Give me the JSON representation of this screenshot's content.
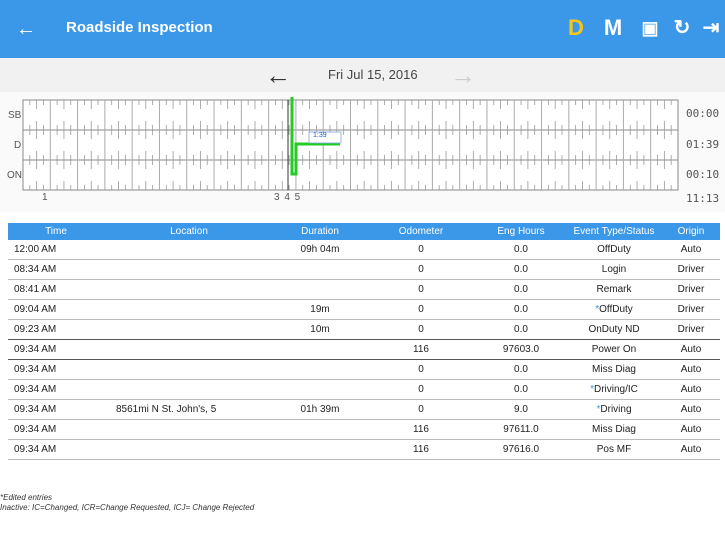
{
  "appbar": {
    "title": "Roadside Inspection",
    "back_icon": "arrow-left-icon",
    "actions": [
      {
        "name": "d-button",
        "label": "D",
        "color": "#f5c518"
      },
      {
        "name": "m-button",
        "label": "M",
        "color": "#ffffff"
      },
      {
        "name": "logbook-icon",
        "label": "▣",
        "color": "#ffffff"
      },
      {
        "name": "refresh-icon",
        "label": "↻",
        "color": "#ffffff"
      },
      {
        "name": "logout-icon",
        "label": "⇥",
        "color": "#ffffff"
      }
    ],
    "color": "#3b97e8"
  },
  "datebar": {
    "date": "Fri Jul 15, 2016",
    "prev_icon": "arrow-left-icon",
    "next_icon": "arrow-right-icon"
  },
  "graph": {
    "row_labels": [
      "SB",
      "D",
      "ON"
    ],
    "totals": [
      "00:00",
      "01:39",
      "00:10"
    ],
    "grand_total": "11:13",
    "bottom_left": "1",
    "bottom_mid": "3 4 5",
    "tooltip": "1:39",
    "status_line_color": "#22cc22"
  },
  "table": {
    "headers": [
      "Time",
      "Location",
      "Duration",
      "Odometer",
      "Eng Hours",
      "Event Type/Status",
      "Origin"
    ],
    "rows": [
      {
        "time": "12:00 AM",
        "location": "",
        "duration": "09h 04m",
        "odometer": "0",
        "eng": "0.0",
        "mark": "",
        "event": "OffDuty",
        "origin": "Auto"
      },
      {
        "time": "08:34 AM",
        "location": "",
        "duration": "",
        "odometer": "0",
        "eng": "0.0",
        "mark": "",
        "event": "Login",
        "origin": "Driver"
      },
      {
        "time": "08:41 AM",
        "location": "",
        "duration": "",
        "odometer": "0",
        "eng": "0.0",
        "mark": "",
        "event": "Remark",
        "origin": "Driver"
      },
      {
        "time": "09:04 AM",
        "location": "",
        "duration": "19m",
        "odometer": "0",
        "eng": "0.0",
        "mark": "*",
        "event": "OffDuty",
        "origin": "Driver"
      },
      {
        "time": "09:23 AM",
        "location": "",
        "duration": "10m",
        "odometer": "0",
        "eng": "0.0",
        "mark": "",
        "event": "OnDuty ND",
        "origin": "Driver"
      },
      {
        "time": "09:34 AM",
        "location": "",
        "duration": "",
        "odometer": "116",
        "eng": "97603.0",
        "mark": "",
        "event": "Power On",
        "origin": "Auto"
      },
      {
        "time": "09:34 AM",
        "location": "",
        "duration": "",
        "odometer": "0",
        "eng": "0.0",
        "mark": "",
        "event": "Miss Diag",
        "origin": "Auto"
      },
      {
        "time": "09:34 AM",
        "location": "",
        "duration": "",
        "odometer": "0",
        "eng": "0.0",
        "mark": "*",
        "event": "Driving/IC",
        "origin": "Auto"
      },
      {
        "time": "09:34 AM",
        "location": "8561mi N St. John's, 5",
        "duration": "01h 39m",
        "odometer": "0",
        "eng": "9.0",
        "mark": "*",
        "event": "Driving",
        "origin": "Auto"
      },
      {
        "time": "09:34 AM",
        "location": "",
        "duration": "",
        "odometer": "116",
        "eng": "97611.0",
        "mark": "",
        "event": "Miss Diag",
        "origin": "Auto"
      },
      {
        "time": "09:34 AM",
        "location": "",
        "duration": "",
        "odometer": "116",
        "eng": "97616.0",
        "mark": "",
        "event": "Pos MF",
        "origin": "Auto"
      }
    ]
  },
  "notes": {
    "line1": "*Edited entries",
    "line2": "Inactive: IC=Changed, ICR=Change Requested, ICJ= Change Rejected"
  }
}
